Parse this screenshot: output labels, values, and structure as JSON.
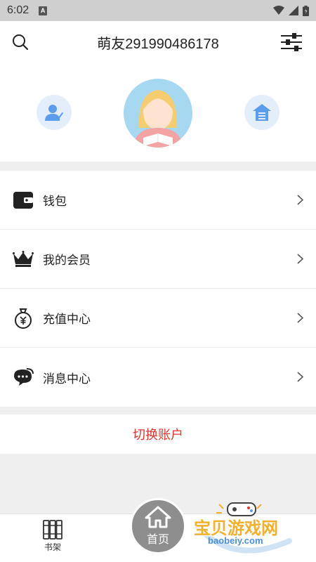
{
  "status_bar": {
    "time": "6:02",
    "notification_letter": "A"
  },
  "header": {
    "title": "萌友291990486178",
    "search_icon": "search-icon",
    "settings_icon": "sliders-icon"
  },
  "profile": {
    "left_icon": "edit-user-icon",
    "avatar": "girl-reading-avatar",
    "right_icon": "home-icon"
  },
  "menu": {
    "items": [
      {
        "label": "钱包",
        "icon": "wallet-icon"
      },
      {
        "label": "我的会员",
        "icon": "crown-icon"
      },
      {
        "label": "充值中心",
        "icon": "yuan-bag-icon"
      },
      {
        "label": "消息中心",
        "icon": "chat-icon"
      }
    ]
  },
  "switch_account": {
    "label": "切换账户"
  },
  "tabbar": {
    "bookshelf_label": "书架",
    "home_label": "首页"
  },
  "watermark": {
    "title": "宝贝游戏网",
    "url": "baobeiy.com"
  },
  "colors": {
    "accent_red": "#e8322e",
    "icon_blue": "#5b9cec",
    "icon_bg": "#e4eefa",
    "avatar_bg": "#a7d8f2"
  }
}
